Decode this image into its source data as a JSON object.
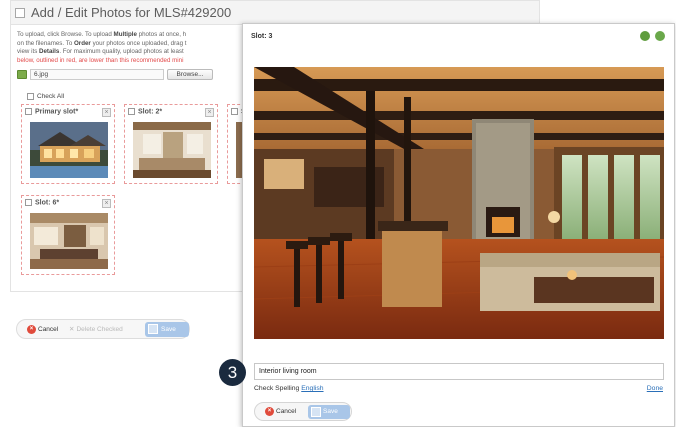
{
  "background_window": {
    "title": "Add / Edit Photos for MLS#429200",
    "instructions": {
      "line1_a": "To upload, click Browse. To upload ",
      "line1_b": "Multiple",
      "line1_c": " photos at once, h",
      "line2": "on the filenames. To ",
      "line2_b": "Order",
      "line2_c": " your photos once uploaded, drag t",
      "line3_a": "view its ",
      "line3_b": "Details",
      "line3_c": ". For maximum quality, upload photos at least",
      "line4_red": "below, outlined in red, are lower than this recommended mini"
    },
    "file_input_value": "6.jpg",
    "browse_label": "Browse...",
    "check_all_label": "Check All",
    "slots": [
      {
        "label": "Primary slot*"
      },
      {
        "label": "Slot: 2*"
      },
      {
        "label": "S"
      },
      {
        "label": "Slot: 6*"
      }
    ],
    "buttons": {
      "cancel": "Cancel",
      "delete_checked": "Delete Checked",
      "save": "Save"
    }
  },
  "dialog": {
    "title": "Slot: 3",
    "caption_value": "Interior living room",
    "check_spelling_label": "Check Spelling",
    "language_link": "English",
    "done_link": "Done",
    "buttons": {
      "cancel": "Cancel",
      "save": "Save"
    }
  },
  "step_badge": "3",
  "colors": {
    "cancel_red": "#e04b3c",
    "save_blue": "#a9c6e8",
    "slot_border": "#e99a9a",
    "link_blue": "#2a6fb8",
    "badge_navy": "#1a2a3e",
    "warning_red": "#e24b4b"
  },
  "icons": {
    "title_checkbox": "checkbox-icon",
    "file": "image-file-icon",
    "slot_remove": "close-icon",
    "cancel": "cancel-circle-icon",
    "delete": "delete-x-icon",
    "save": "save-disk-icon",
    "dialog_rotate_left": "rotate-left-icon",
    "dialog_rotate_right": "rotate-right-icon"
  }
}
